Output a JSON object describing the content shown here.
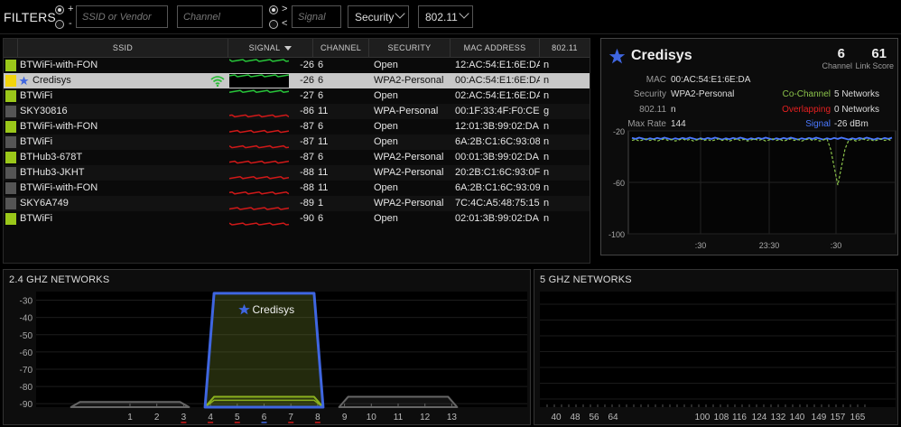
{
  "filters": {
    "label": "FILTERS",
    "radio_plus": "+",
    "radio_minus": "-",
    "ssid_placeholder": "SSID or Vendor",
    "channel_placeholder": "Channel",
    "radio_gt": ">",
    "radio_lt": "<",
    "signal_placeholder": "Signal",
    "security_label": "Security",
    "mode_label": "802.11"
  },
  "table": {
    "headers": {
      "ssid": "SSID",
      "signal": "SIGNAL",
      "channel": "CHANNEL",
      "security": "SECURITY",
      "mac": "MAC ADDRESS",
      "mode": "802.11"
    },
    "rows": [
      {
        "ssid": "BTWiFi-with-FON",
        "signal": "-26",
        "channel": "6",
        "security": "Open",
        "mac": "12:AC:54:E1:6E:DA",
        "mode": "n",
        "color": "#9ac71a",
        "trace": "#27c43a"
      },
      {
        "ssid": "Credisys",
        "signal": "-26",
        "channel": "6",
        "security": "WPA2-Personal",
        "mac": "00:AC:54:E1:6E:DA",
        "mode": "n",
        "color": "#f2d40c",
        "trace": "#27c43a",
        "selected": true
      },
      {
        "ssid": "BTWiFi",
        "signal": "-27",
        "channel": "6",
        "security": "Open",
        "mac": "02:AC:54:E1:6E:DA",
        "mode": "n",
        "color": "#9ac71a",
        "trace": "#27c43a"
      },
      {
        "ssid": "SKY30816",
        "signal": "-86",
        "channel": "11",
        "security": "WPA-Personal",
        "mac": "00:1F:33:4F:F0:CE",
        "mode": "g",
        "color": "#555555",
        "trace": "#d01818"
      },
      {
        "ssid": "BTWiFi-with-FON",
        "signal": "-87",
        "channel": "6",
        "security": "Open",
        "mac": "12:01:3B:99:02:DA",
        "mode": "n",
        "color": "#9ac71a",
        "trace": "#d01818"
      },
      {
        "ssid": "BTWiFi",
        "signal": "-87",
        "channel": "11",
        "security": "Open",
        "mac": "6A:2B:C1:6C:93:08",
        "mode": "n",
        "color": "#555555",
        "trace": "#d01818"
      },
      {
        "ssid": "BTHub3-678T",
        "signal": "-87",
        "channel": "6",
        "security": "WPA2-Personal",
        "mac": "00:01:3B:99:02:DA",
        "mode": "n",
        "color": "#9ac71a",
        "trace": "#d01818"
      },
      {
        "ssid": "BTHub3-JKHT",
        "signal": "-88",
        "channel": "11",
        "security": "WPA2-Personal",
        "mac": "20:2B:C1:6C:93:0F",
        "mode": "n",
        "color": "#555555",
        "trace": "#d01818"
      },
      {
        "ssid": "BTWiFi-with-FON",
        "signal": "-88",
        "channel": "11",
        "security": "Open",
        "mac": "6A:2B:C1:6C:93:09",
        "mode": "n",
        "color": "#555555",
        "trace": "#d01818"
      },
      {
        "ssid": "SKY6A749",
        "signal": "-89",
        "channel": "1",
        "security": "WPA2-Personal",
        "mac": "7C:4C:A5:48:75:15",
        "mode": "n",
        "color": "#555555",
        "trace": "#d01818"
      },
      {
        "ssid": "BTWiFi",
        "signal": "-90",
        "channel": "6",
        "security": "Open",
        "mac": "02:01:3B:99:02:DA",
        "mode": "n",
        "color": "#9ac71a",
        "trace": "#d01818"
      }
    ]
  },
  "detail": {
    "name": "Credisys",
    "channel_value": "6",
    "channel_label": "Channel",
    "score_value": "61",
    "score_label": "Link Score",
    "mac_key": "MAC",
    "mac_value": "00:AC:54:E1:6E:DA",
    "security_key": "Security",
    "security_value": "WPA2-Personal",
    "mode_key": "802.11",
    "mode_value": "n",
    "rate_key": "Max Rate",
    "rate_value": "144",
    "cochannel_key": "Co-Channel",
    "cochannel_value": "5 Networks",
    "overlap_key": "Overlapping",
    "overlap_value": "0 Networks",
    "signal_key": "Signal",
    "signal_value": "-26 dBm",
    "colors": {
      "cochannel": "#8bc34a",
      "overlap": "#e52020",
      "signal": "#4a78ff"
    },
    "graph": {
      "y_ticks": [
        "-20",
        "-60",
        "-100"
      ],
      "x_ticks": [
        ":30",
        "23:30",
        ":30"
      ]
    }
  },
  "band24": {
    "title": "2.4 GHZ NETWORKS",
    "y_ticks": [
      "-30",
      "-40",
      "-50",
      "-60",
      "-70",
      "-80",
      "-90"
    ],
    "channels": [
      "1",
      "2",
      "3",
      "4",
      "5",
      "6",
      "7",
      "8",
      "9",
      "10",
      "11",
      "12",
      "13"
    ],
    "selected_label": "Credisys",
    "signal_floor": -92,
    "networks": [
      {
        "center": 6,
        "top": -26,
        "kind": "selected"
      },
      {
        "center": 6,
        "top": -86,
        "kind": "green"
      },
      {
        "center": 6,
        "top": -88,
        "kind": "green2"
      },
      {
        "center": 1,
        "top": -89,
        "kind": "gray"
      },
      {
        "center": 11,
        "top": -86,
        "kind": "gray"
      }
    ]
  },
  "band5": {
    "title": "5 GHZ NETWORKS",
    "channels": [
      "40",
      "48",
      "56",
      "64",
      "100",
      "108",
      "116",
      "124",
      "132",
      "140",
      "149",
      "157",
      "165"
    ]
  }
}
